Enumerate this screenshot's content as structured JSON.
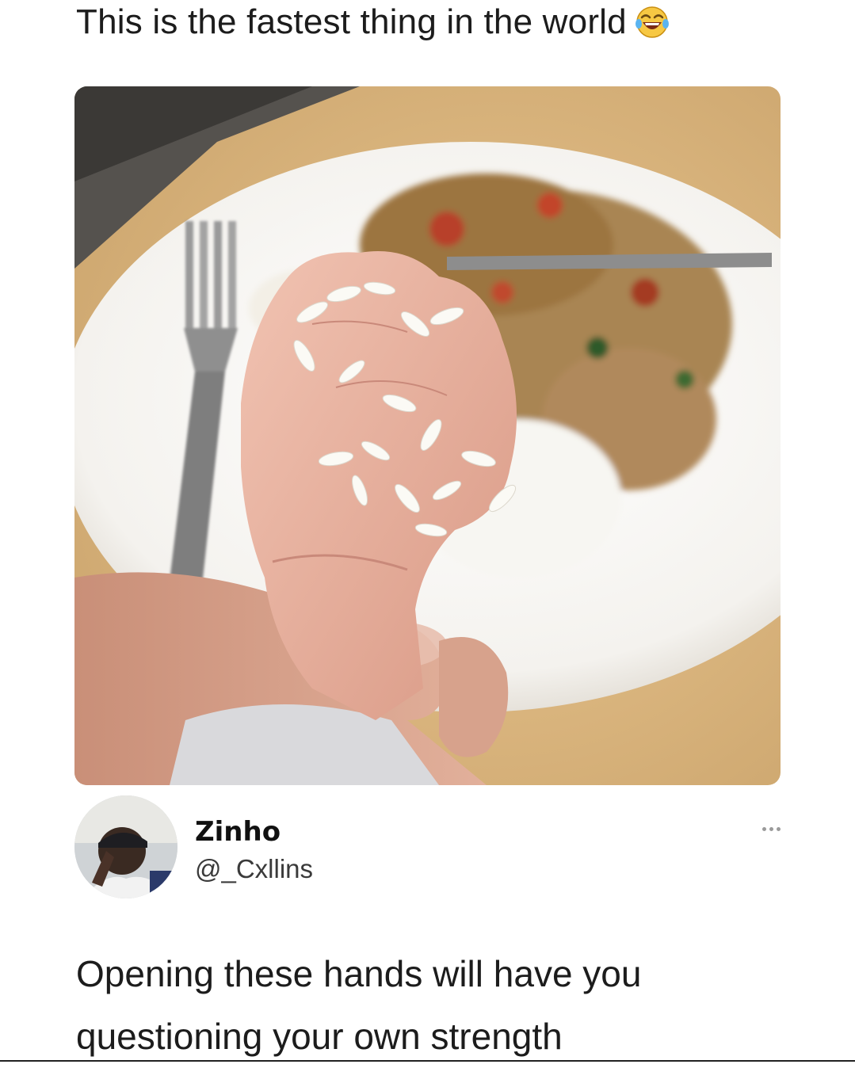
{
  "caption": {
    "text": "This is the fastest thing in the world",
    "emoji_icon": "face-with-tears-of-joy-icon"
  },
  "post_image": {
    "icon": "baby-fist-holding-rice-photo"
  },
  "tweet": {
    "display_name": "Zinho",
    "handle": "@_Cxllins",
    "avatar_icon": "user-avatar-photo",
    "more_icon": "ellipsis-icon",
    "body": "Opening these hands will have you questioning your own strength"
  }
}
